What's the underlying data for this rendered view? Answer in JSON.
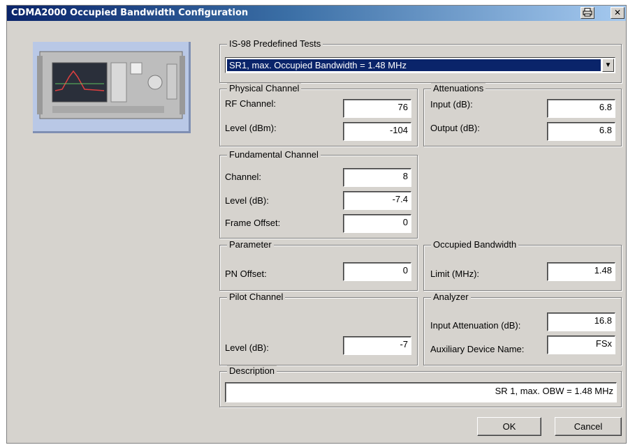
{
  "window": {
    "title": "CDMA2000  Occupied Bandwidth Configuration",
    "print_icon": "print-icon",
    "close_symbol": "✕"
  },
  "predefined": {
    "legend": "IS-98 Predefined Tests",
    "selected": "SR1, max. Occupied Bandwidth = 1.48 MHz",
    "arrow_icon": "chevron-down-icon"
  },
  "physical": {
    "legend": "Physical Channel",
    "rf_label": "RF Channel:",
    "rf_value": "76",
    "level_label": "Level (dBm):",
    "level_value": "-104"
  },
  "attenuations": {
    "legend": "Attenuations",
    "input_label": "Input (dB):",
    "input_value": "6.8",
    "output_label": "Output (dB):",
    "output_value": "6.8"
  },
  "fundamental": {
    "legend": "Fundamental Channel",
    "channel_label": "Channel:",
    "channel_value": "8",
    "level_label": "Level (dB):",
    "level_value": "-7.4",
    "frame_label": "Frame Offset:",
    "frame_value": "0"
  },
  "parameter": {
    "legend": "Parameter",
    "pn_label": "PN Offset:",
    "pn_value": "0"
  },
  "obw": {
    "legend": "Occupied Bandwidth",
    "limit_label": "Limit (MHz):",
    "limit_value": "1.48"
  },
  "pilot": {
    "legend": "Pilot Channel",
    "level_label": "Level (dB):",
    "level_value": "-7"
  },
  "analyzer": {
    "legend": "Analyzer",
    "att_label": "Input Attenuation (dB):",
    "att_value": "16.8",
    "aux_label": "Auxiliary Device Name:",
    "aux_value": "FSx"
  },
  "description": {
    "legend": "Description",
    "value": "SR 1, max. OBW = 1.48 MHz"
  },
  "buttons": {
    "ok": "OK",
    "cancel": "Cancel"
  }
}
